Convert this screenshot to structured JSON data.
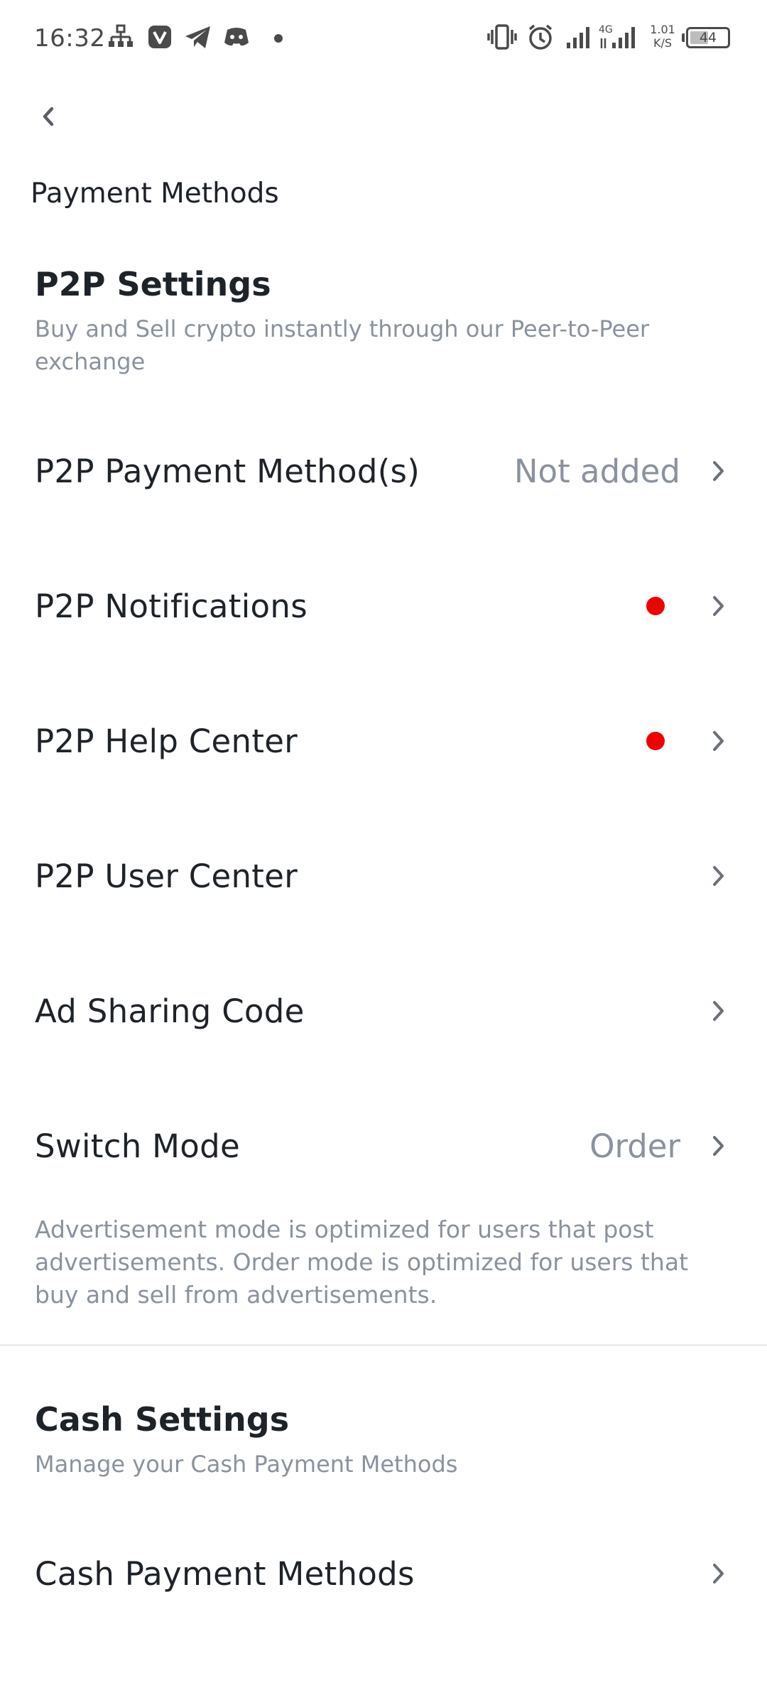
{
  "status_bar": {
    "time": "16:32",
    "net_speed_value": "1.01",
    "net_speed_unit": "K/S",
    "network_label": "4G",
    "battery": "44",
    "icons": [
      "sitemap-icon",
      "app-shield-icon",
      "telegram-icon",
      "discord-icon",
      "dot-icon",
      "vibrate-icon",
      "alarm-icon",
      "signal-icon",
      "signal-4g-icon"
    ]
  },
  "header": {
    "title": "Payment Methods"
  },
  "p2p": {
    "title": "P2P Settings",
    "description": "Buy and Sell crypto instantly through our Peer-to-Peer exchange",
    "rows": [
      {
        "label": "P2P Payment Method(s)",
        "value": "Not added"
      },
      {
        "label": "P2P Notifications",
        "value": ""
      },
      {
        "label": "P2P Help Center",
        "value": ""
      },
      {
        "label": "P2P User Center",
        "value": ""
      },
      {
        "label": "Ad Sharing Code",
        "value": ""
      },
      {
        "label": "Switch Mode",
        "value": "Order"
      }
    ],
    "mode_note": "Advertisement mode is optimized for users that post advertisements. Order mode is optimized for users that buy and sell from advertisements."
  },
  "cash": {
    "title": "Cash Settings",
    "description": "Manage your Cash Payment Methods",
    "rows": [
      {
        "label": "Cash Payment Methods",
        "value": ""
      }
    ]
  },
  "colors": {
    "text_primary": "#1e2329",
    "text_secondary": "#8a929d",
    "notification_dot": "#f00000",
    "divider": "#eaecef"
  }
}
